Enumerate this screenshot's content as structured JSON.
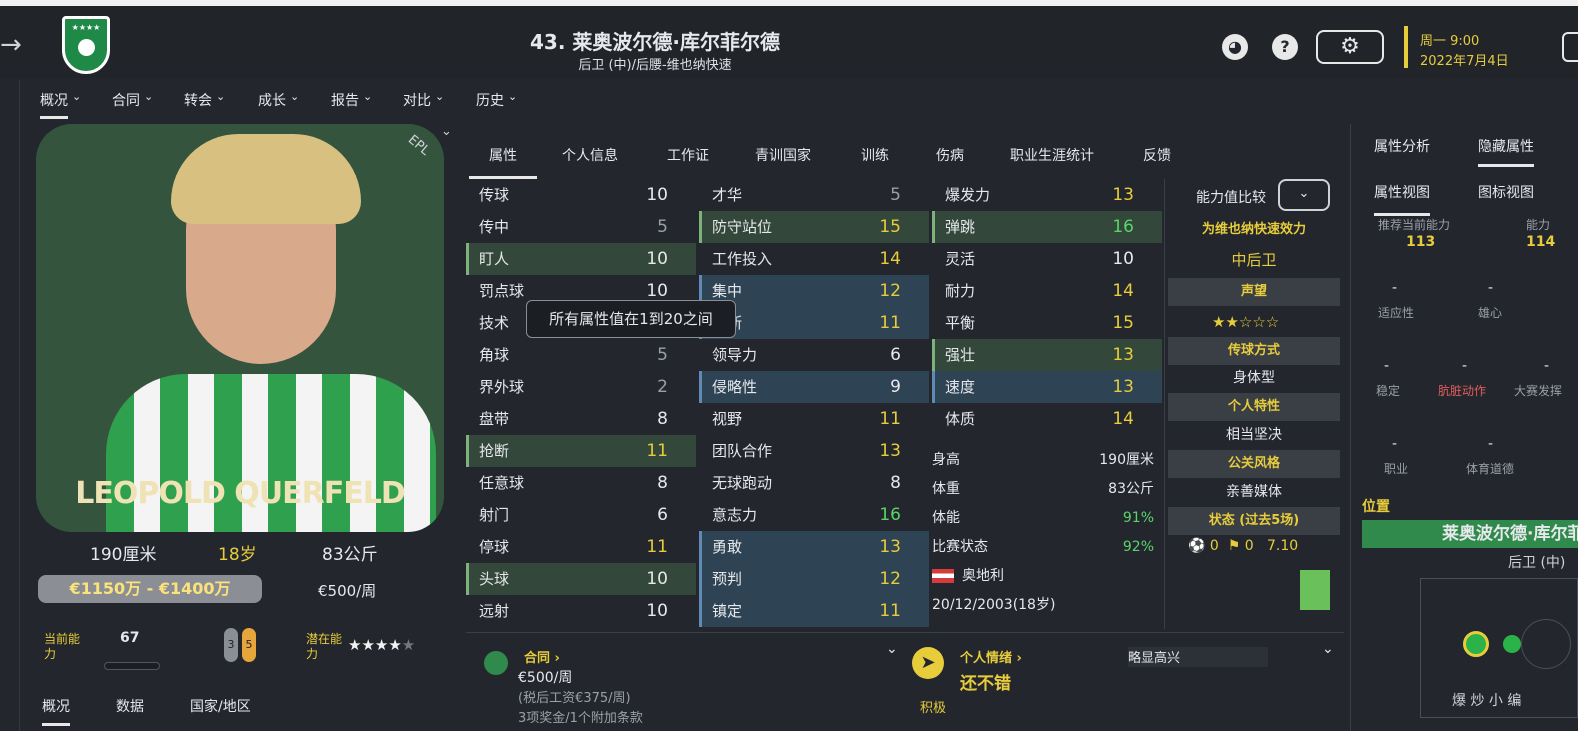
{
  "header": {
    "title": "43. 莱奥波尔德·库尔菲尔德",
    "subtitle": "后卫 (中)/后腰-维也纳快速",
    "day": "周一 9:00",
    "date": "2022年7月4日",
    "back_icon": "→",
    "crest_stars": "★★★★"
  },
  "menu": [
    "概况",
    "合同",
    "转会",
    "成长",
    "报告",
    "对比",
    "历史"
  ],
  "card": {
    "name": "LEOPOLD QUERFELD",
    "badge": "EPL",
    "height": "190厘米",
    "age": "18岁",
    "weight": "83公斤",
    "value": "€1150万 - €1400万",
    "wage": "€500/周",
    "ca_label": "当前能力",
    "ca_value": "67",
    "pa_label": "潜在能力",
    "pills": [
      "3",
      "5"
    ]
  },
  "left_subtabs": [
    "概况",
    "数据",
    "国家/地区"
  ],
  "center_tabs": [
    "属性",
    "个人信息",
    "工作证",
    "青训国家",
    "训练",
    "伤病",
    "职业生涯统计",
    "反馈"
  ],
  "attrs": {
    "col1": [
      [
        "传球",
        "10",
        "w",
        ""
      ],
      [
        "传中",
        "5",
        "dim",
        ""
      ],
      [
        "盯人",
        "10",
        "w",
        "g"
      ],
      [
        "罚点球",
        "10",
        "w",
        ""
      ],
      [
        "技术",
        "",
        "",
        ""
      ],
      [
        "角球",
        "5",
        "dim",
        ""
      ],
      [
        "界外球",
        "2",
        "dim",
        ""
      ],
      [
        "盘带",
        "8",
        "w",
        ""
      ],
      [
        "抢断",
        "11",
        "y",
        "g"
      ],
      [
        "任意球",
        "8",
        "w",
        ""
      ],
      [
        "射门",
        "6",
        "w",
        ""
      ],
      [
        "停球",
        "11",
        "y",
        ""
      ],
      [
        "头球",
        "10",
        "w",
        "g"
      ],
      [
        "远射",
        "10",
        "w",
        ""
      ]
    ],
    "col2": [
      [
        "才华",
        "5",
        "dim",
        ""
      ],
      [
        "防守站位",
        "15",
        "y",
        "g"
      ],
      [
        "工作投入",
        "14",
        "y",
        ""
      ],
      [
        "集中",
        "12",
        "y",
        "b"
      ],
      [
        "判断",
        "11",
        "y",
        "b"
      ],
      [
        "领导力",
        "6",
        "w",
        ""
      ],
      [
        "侵略性",
        "9",
        "w",
        "b"
      ],
      [
        "视野",
        "11",
        "y",
        ""
      ],
      [
        "团队合作",
        "13",
        "y",
        ""
      ],
      [
        "无球跑动",
        "8",
        "w",
        ""
      ],
      [
        "意志力",
        "16",
        "gr",
        ""
      ],
      [
        "勇敢",
        "13",
        "y",
        "b"
      ],
      [
        "预判",
        "12",
        "y",
        "b"
      ],
      [
        "镇定",
        "11",
        "y",
        "b"
      ]
    ],
    "col3": [
      [
        "爆发力",
        "13",
        "y",
        ""
      ],
      [
        "弹跳",
        "16",
        "gr",
        "g"
      ],
      [
        "灵活",
        "10",
        "w",
        ""
      ],
      [
        "耐力",
        "14",
        "y",
        ""
      ],
      [
        "平衡",
        "15",
        "y",
        ""
      ],
      [
        "强壮",
        "13",
        "y",
        "g"
      ],
      [
        "速度",
        "13",
        "y",
        "b"
      ],
      [
        "体质",
        "14",
        "y",
        ""
      ]
    ]
  },
  "tooltip": "所有属性值在1到20之间",
  "info": {
    "height_label": "身高",
    "height": "190厘米",
    "weight_label": "体重",
    "weight": "83公斤",
    "fitness_label": "体能",
    "fitness": "91%",
    "form_label": "比赛状态",
    "form": "92%",
    "nation": "奥地利",
    "dob": "20/12/2003(18岁)"
  },
  "profile": {
    "compare": "能力值比较",
    "club_line": "为维也纳快速效力",
    "role": "中后卫",
    "rep_hdr": "声望",
    "rep_stars": "★★☆☆☆",
    "pass_hdr": "传球方式",
    "pass": "身体型",
    "trait_hdr": "个人特性",
    "trait": "相当坚决",
    "media_hdr": "公关风格",
    "media": "亲善媒体",
    "form_hdr": "状态 (过去5场)",
    "form_g": "0",
    "form_a": "0",
    "form_r": "7.10"
  },
  "right": {
    "tabs": [
      "属性分析",
      "隐藏属性"
    ],
    "view_tabs": [
      "属性视图",
      "图标视图"
    ],
    "rec_label": "推荐当前能力",
    "rec_value": "113",
    "ab_label": "能力",
    "ab_value": "114",
    "hidden": [
      "适应性",
      "雄心",
      "稳定",
      "肮脏动作",
      "大赛发挥",
      "职业",
      "体育道德"
    ],
    "pos_label": "位置",
    "pos_name": "莱奥波尔德·库尔菲尔德",
    "pos_role": "后卫 (中)"
  },
  "bottom": {
    "contract_label": "合同",
    "contract_wage": "€500/周",
    "after_tax": "(税后工资€375/周)",
    "bonus": "3项奖金/1个附加条款",
    "mood_label": "个人情绪",
    "mood_state": "略显高兴",
    "mood_text": "还不错",
    "mood_tag": "积极"
  },
  "watermark": "爆 炒 小 编"
}
